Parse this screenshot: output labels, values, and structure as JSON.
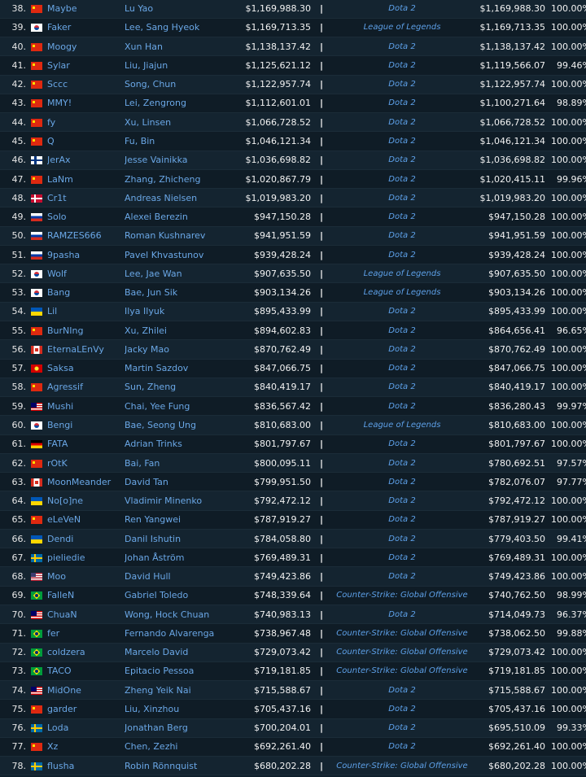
{
  "rows": [
    {
      "rank": "38.",
      "flag": "cn",
      "nick": "Maybe",
      "name": "Lu Yao",
      "total": "$1,169,988.30",
      "sep": "|",
      "game": "Dota 2",
      "top": "$1,169,988.30",
      "pct": "100.00%"
    },
    {
      "rank": "39.",
      "flag": "kr",
      "nick": "Faker",
      "name": "Lee, Sang Hyeok",
      "total": "$1,169,713.35",
      "sep": "|",
      "game": "League of Legends",
      "top": "$1,169,713.35",
      "pct": "100.00%"
    },
    {
      "rank": "40.",
      "flag": "cn",
      "nick": "Moogy",
      "name": "Xun Han",
      "total": "$1,138,137.42",
      "sep": "|",
      "game": "Dota 2",
      "top": "$1,138,137.42",
      "pct": "100.00%"
    },
    {
      "rank": "41.",
      "flag": "cn",
      "nick": "Sylar",
      "name": "Liu, Jiajun",
      "total": "$1,125,621.12",
      "sep": "|",
      "game": "Dota 2",
      "top": "$1,119,566.07",
      "pct": "99.46%"
    },
    {
      "rank": "42.",
      "flag": "cn",
      "nick": "Sccc",
      "name": "Song, Chun",
      "total": "$1,122,957.74",
      "sep": "|",
      "game": "Dota 2",
      "top": "$1,122,957.74",
      "pct": "100.00%"
    },
    {
      "rank": "43.",
      "flag": "cn",
      "nick": "MMY!",
      "name": "Lei, Zengrong",
      "total": "$1,112,601.01",
      "sep": "|",
      "game": "Dota 2",
      "top": "$1,100,271.64",
      "pct": "98.89%"
    },
    {
      "rank": "44.",
      "flag": "cn",
      "nick": "fy",
      "name": "Xu, Linsen",
      "total": "$1,066,728.52",
      "sep": "|",
      "game": "Dota 2",
      "top": "$1,066,728.52",
      "pct": "100.00%"
    },
    {
      "rank": "45.",
      "flag": "cn",
      "nick": "Q",
      "name": "Fu, Bin",
      "total": "$1,046,121.34",
      "sep": "|",
      "game": "Dota 2",
      "top": "$1,046,121.34",
      "pct": "100.00%"
    },
    {
      "rank": "46.",
      "flag": "fi",
      "nick": "JerAx",
      "name": "Jesse Vainikka",
      "total": "$1,036,698.82",
      "sep": "|",
      "game": "Dota 2",
      "top": "$1,036,698.82",
      "pct": "100.00%"
    },
    {
      "rank": "47.",
      "flag": "cn",
      "nick": "LaNm",
      "name": "Zhang, Zhicheng",
      "total": "$1,020,867.79",
      "sep": "|",
      "game": "Dota 2",
      "top": "$1,020,415.11",
      "pct": "99.96%"
    },
    {
      "rank": "48.",
      "flag": "dk",
      "nick": "Cr1t",
      "name": "Andreas Nielsen",
      "total": "$1,019,983.20",
      "sep": "|",
      "game": "Dota 2",
      "top": "$1,019,983.20",
      "pct": "100.00%"
    },
    {
      "rank": "49.",
      "flag": "ru",
      "nick": "Solo",
      "name": "Alexei Berezin",
      "total": "$947,150.28",
      "sep": "|",
      "game": "Dota 2",
      "top": "$947,150.28",
      "pct": "100.00%"
    },
    {
      "rank": "50.",
      "flag": "ru",
      "nick": "RAMZES666",
      "name": "Roman Kushnarev",
      "total": "$941,951.59",
      "sep": "|",
      "game": "Dota 2",
      "top": "$941,951.59",
      "pct": "100.00%"
    },
    {
      "rank": "51.",
      "flag": "ru",
      "nick": "9pasha",
      "name": "Pavel Khvastunov",
      "total": "$939,428.24",
      "sep": "|",
      "game": "Dota 2",
      "top": "$939,428.24",
      "pct": "100.00%"
    },
    {
      "rank": "52.",
      "flag": "kr",
      "nick": "Wolf",
      "name": "Lee, Jae Wan",
      "total": "$907,635.50",
      "sep": "|",
      "game": "League of Legends",
      "top": "$907,635.50",
      "pct": "100.00%"
    },
    {
      "rank": "53.",
      "flag": "kr",
      "nick": "Bang",
      "name": "Bae, Jun Sik",
      "total": "$903,134.26",
      "sep": "|",
      "game": "League of Legends",
      "top": "$903,134.26",
      "pct": "100.00%"
    },
    {
      "rank": "54.",
      "flag": "ua",
      "nick": "Lil",
      "name": "Ilya Ilyuk",
      "total": "$895,433.99",
      "sep": "|",
      "game": "Dota 2",
      "top": "$895,433.99",
      "pct": "100.00%"
    },
    {
      "rank": "55.",
      "flag": "cn",
      "nick": "BurNIng",
      "name": "Xu, Zhilei",
      "total": "$894,602.83",
      "sep": "|",
      "game": "Dota 2",
      "top": "$864,656.41",
      "pct": "96.65%"
    },
    {
      "rank": "56.",
      "flag": "ca",
      "nick": "EternaLEnVy",
      "name": "Jacky Mao",
      "total": "$870,762.49",
      "sep": "|",
      "game": "Dota 2",
      "top": "$870,762.49",
      "pct": "100.00%"
    },
    {
      "rank": "57.",
      "flag": "mk",
      "nick": "Saksa",
      "name": "Martin Sazdov",
      "total": "$847,066.75",
      "sep": "|",
      "game": "Dota 2",
      "top": "$847,066.75",
      "pct": "100.00%"
    },
    {
      "rank": "58.",
      "flag": "cn",
      "nick": "Agressif",
      "name": "Sun, Zheng",
      "total": "$840,419.17",
      "sep": "|",
      "game": "Dota 2",
      "top": "$840,419.17",
      "pct": "100.00%"
    },
    {
      "rank": "59.",
      "flag": "my",
      "nick": "Mushi",
      "name": "Chai, Yee Fung",
      "total": "$836,567.42",
      "sep": "|",
      "game": "Dota 2",
      "top": "$836,280.43",
      "pct": "99.97%"
    },
    {
      "rank": "60.",
      "flag": "kr",
      "nick": "Bengi",
      "name": "Bae, Seong Ung",
      "total": "$810,683.00",
      "sep": "|",
      "game": "League of Legends",
      "top": "$810,683.00",
      "pct": "100.00%"
    },
    {
      "rank": "61.",
      "flag": "de",
      "nick": "FATA",
      "name": "Adrian Trinks",
      "total": "$801,797.67",
      "sep": "|",
      "game": "Dota 2",
      "top": "$801,797.67",
      "pct": "100.00%"
    },
    {
      "rank": "62.",
      "flag": "cn",
      "nick": "rOtK",
      "name": "Bai, Fan",
      "total": "$800,095.11",
      "sep": "|",
      "game": "Dota 2",
      "top": "$780,692.51",
      "pct": "97.57%"
    },
    {
      "rank": "63.",
      "flag": "ca",
      "nick": "MoonMeander",
      "name": "David Tan",
      "total": "$799,951.50",
      "sep": "|",
      "game": "Dota 2",
      "top": "$782,076.07",
      "pct": "97.77%"
    },
    {
      "rank": "64.",
      "flag": "ua",
      "nick": "No[o]ne",
      "name": "Vladimir Minenko",
      "total": "$792,472.12",
      "sep": "|",
      "game": "Dota 2",
      "top": "$792,472.12",
      "pct": "100.00%"
    },
    {
      "rank": "65.",
      "flag": "cn",
      "nick": "eLeVeN",
      "name": "Ren Yangwei",
      "total": "$787,919.27",
      "sep": "|",
      "game": "Dota 2",
      "top": "$787,919.27",
      "pct": "100.00%"
    },
    {
      "rank": "66.",
      "flag": "ua",
      "nick": "Dendi",
      "name": "Danil Ishutin",
      "total": "$784,058.80",
      "sep": "|",
      "game": "Dota 2",
      "top": "$779,403.50",
      "pct": "99.41%"
    },
    {
      "rank": "67.",
      "flag": "se",
      "nick": "pieliedie",
      "name": "Johan Åström",
      "total": "$769,489.31",
      "sep": "|",
      "game": "Dota 2",
      "top": "$769,489.31",
      "pct": "100.00%"
    },
    {
      "rank": "68.",
      "flag": "us",
      "nick": "Moo",
      "name": "David Hull",
      "total": "$749,423.86",
      "sep": "|",
      "game": "Dota 2",
      "top": "$749,423.86",
      "pct": "100.00%"
    },
    {
      "rank": "69.",
      "flag": "br",
      "nick": "FalleN",
      "name": "Gabriel Toledo",
      "total": "$748,339.64",
      "sep": "|",
      "game": "Counter-Strike: Global Offensive",
      "top": "$740,762.50",
      "pct": "98.99%"
    },
    {
      "rank": "70.",
      "flag": "my",
      "nick": "ChuaN",
      "name": "Wong, Hock Chuan",
      "total": "$740,983.13",
      "sep": "|",
      "game": "Dota 2",
      "top": "$714,049.73",
      "pct": "96.37%"
    },
    {
      "rank": "71.",
      "flag": "br",
      "nick": "fer",
      "name": "Fernando Alvarenga",
      "total": "$738,967.48",
      "sep": "|",
      "game": "Counter-Strike: Global Offensive",
      "top": "$738,062.50",
      "pct": "99.88%"
    },
    {
      "rank": "72.",
      "flag": "br",
      "nick": "coldzera",
      "name": "Marcelo David",
      "total": "$729,073.42",
      "sep": "|",
      "game": "Counter-Strike: Global Offensive",
      "top": "$729,073.42",
      "pct": "100.00%"
    },
    {
      "rank": "73.",
      "flag": "br",
      "nick": "TACO",
      "name": "Epitacio Pessoa",
      "total": "$719,181.85",
      "sep": "|",
      "game": "Counter-Strike: Global Offensive",
      "top": "$719,181.85",
      "pct": "100.00%"
    },
    {
      "rank": "74.",
      "flag": "my",
      "nick": "MidOne",
      "name": "Zheng Yeik Nai",
      "total": "$715,588.67",
      "sep": "|",
      "game": "Dota 2",
      "top": "$715,588.67",
      "pct": "100.00%"
    },
    {
      "rank": "75.",
      "flag": "cn",
      "nick": "garder",
      "name": "Liu, Xinzhou",
      "total": "$705,437.16",
      "sep": "|",
      "game": "Dota 2",
      "top": "$705,437.16",
      "pct": "100.00%"
    },
    {
      "rank": "76.",
      "flag": "se",
      "nick": "Loda",
      "name": "Jonathan Berg",
      "total": "$700,204.01",
      "sep": "|",
      "game": "Dota 2",
      "top": "$695,510.09",
      "pct": "99.33%"
    },
    {
      "rank": "77.",
      "flag": "cn",
      "nick": "Xz",
      "name": "Chen, Zezhi",
      "total": "$692,261.40",
      "sep": "|",
      "game": "Dota 2",
      "top": "$692,261.40",
      "pct": "100.00%"
    },
    {
      "rank": "78.",
      "flag": "se",
      "nick": "flusha",
      "name": "Robin Rönnquist",
      "total": "$680,202.28",
      "sep": "|",
      "game": "Counter-Strike: Global Offensive",
      "top": "$680,202.28",
      "pct": "100.00%"
    }
  ]
}
